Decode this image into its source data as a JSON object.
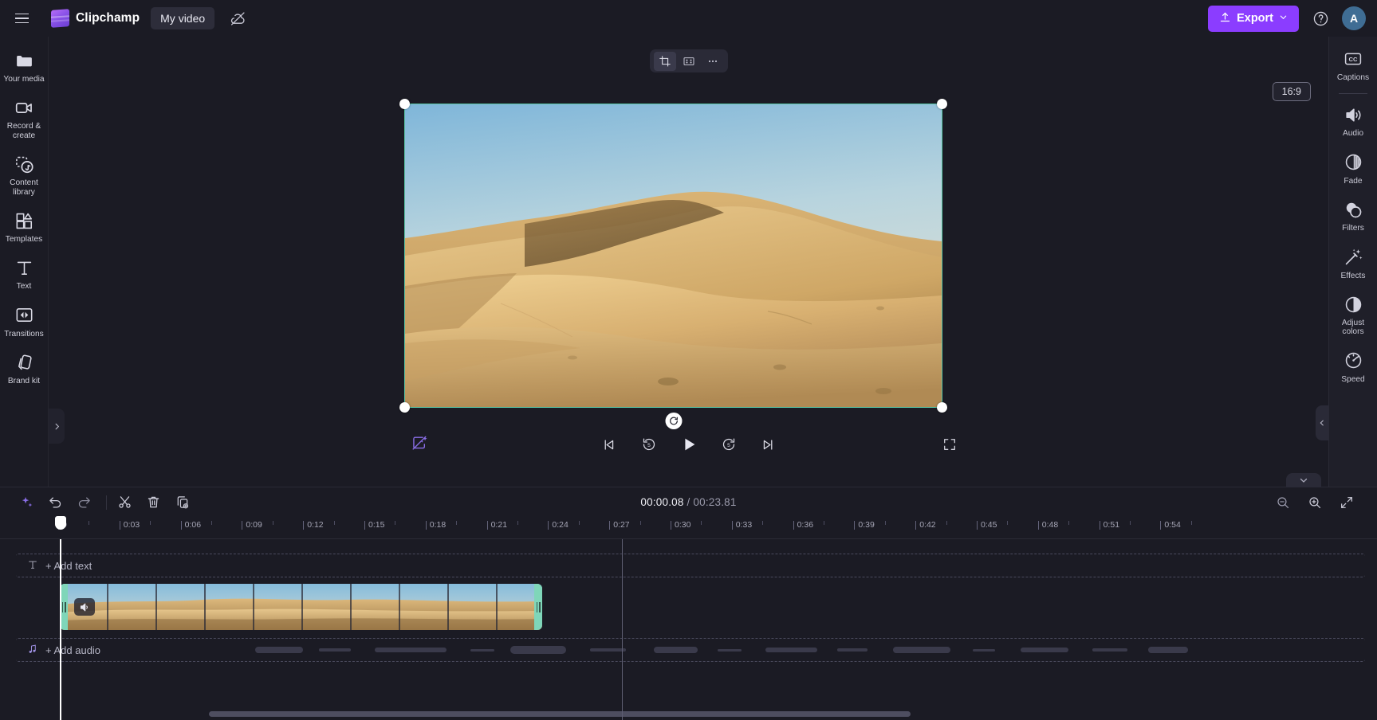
{
  "app": {
    "brand_name": "Clipchamp",
    "project_name": "My video"
  },
  "topbar": {
    "menu_icon": "hamburger-menu-icon",
    "logo_icon": "clipchamp-logo-icon",
    "cloud_icon": "cloud-offline-icon",
    "export_label": "Export",
    "export_icon": "upload-icon",
    "export_chevron": "chevron-down-icon",
    "help_icon": "help-circle-icon",
    "avatar_initial": "A",
    "accent_color": "#8b3dff",
    "avatar_color": "#3f6d94"
  },
  "left_rail": {
    "items": [
      {
        "label": "Your media",
        "icon": "folder-icon"
      },
      {
        "label": "Record & create",
        "icon": "video-camera-icon"
      },
      {
        "label": "Content library",
        "icon": "content-library-icon"
      },
      {
        "label": "Templates",
        "icon": "templates-grid-icon"
      },
      {
        "label": "Text",
        "icon": "text-t-icon"
      },
      {
        "label": "Transitions",
        "icon": "transitions-icon"
      },
      {
        "label": "Brand kit",
        "icon": "brand-kit-icon"
      }
    ],
    "collapse_icon": "chevron-right-icon"
  },
  "right_rail": {
    "items": [
      {
        "label": "Captions",
        "icon": "closed-captions-icon"
      },
      {
        "label": "Audio",
        "icon": "speaker-volume-icon"
      },
      {
        "label": "Fade",
        "icon": "fade-circle-icon"
      },
      {
        "label": "Filters",
        "icon": "filters-overlap-icon"
      },
      {
        "label": "Effects",
        "icon": "effects-wand-icon"
      },
      {
        "label": "Adjust colors",
        "icon": "contrast-half-circle-icon"
      },
      {
        "label": "Speed",
        "icon": "speedometer-icon"
      }
    ],
    "collapse_icon": "chevron-left-icon"
  },
  "preview": {
    "float_tools": [
      {
        "icon": "crop-icon",
        "name": "crop-tool",
        "active": true
      },
      {
        "icon": "fit-to-frame-icon",
        "name": "fit-tool",
        "active": false
      },
      {
        "icon": "more-options-icon",
        "name": "more-tool",
        "active": false
      }
    ],
    "aspect_ratio": "16:9",
    "selection_color": "#58c7a6",
    "magic_icon": "magic-eraser-icon",
    "rotate_icon": "rotate-icon",
    "controls": [
      {
        "icon": "skip-previous-icon",
        "name": "skip-to-start-button"
      },
      {
        "icon": "rewind-5-icon",
        "name": "rewind-5-seconds-button"
      },
      {
        "icon": "play-icon",
        "name": "play-button"
      },
      {
        "icon": "forward-5-icon",
        "name": "forward-5-seconds-button"
      },
      {
        "icon": "skip-next-icon",
        "name": "skip-to-end-button"
      }
    ],
    "fullscreen_icon": "fullscreen-icon"
  },
  "timeline": {
    "collapse_icon": "chevron-down-icon",
    "toolbar_left": [
      {
        "icon": "ai-sparkle-icon",
        "name": "ai-tools-button"
      },
      {
        "icon": "undo-icon",
        "name": "undo-button"
      },
      {
        "icon": "redo-icon",
        "name": "redo-button"
      },
      {
        "icon": "split-scissors-icon",
        "name": "split-button"
      },
      {
        "icon": "trash-icon",
        "name": "delete-button"
      },
      {
        "icon": "duplicate-icon",
        "name": "duplicate-button"
      }
    ],
    "current_time": "00:00.08",
    "time_separator": " / ",
    "total_time": "00:23.81",
    "toolbar_right": [
      {
        "icon": "zoom-out-icon",
        "name": "zoom-out-button"
      },
      {
        "icon": "zoom-in-icon",
        "name": "zoom-in-button"
      },
      {
        "icon": "fit-timeline-icon",
        "name": "fit-timeline-button"
      }
    ],
    "ruler_labels": [
      "0",
      "0:03",
      "0:06",
      "0:09",
      "0:12",
      "0:15",
      "0:18",
      "0:21",
      "0:24",
      "0:27",
      "0:30",
      "0:33",
      "0:36",
      "0:39",
      "0:42",
      "0:45",
      "0:48",
      "0:51",
      "0:54"
    ],
    "text_track": {
      "label": "+ Add text",
      "icon": "text-t-icon"
    },
    "audio_track": {
      "label": "+ Add audio",
      "icon": "music-note-icon"
    },
    "video_clip": {
      "name": "desert-dunes-clip",
      "mute_icon": "speaker-icon",
      "selected": true
    }
  }
}
